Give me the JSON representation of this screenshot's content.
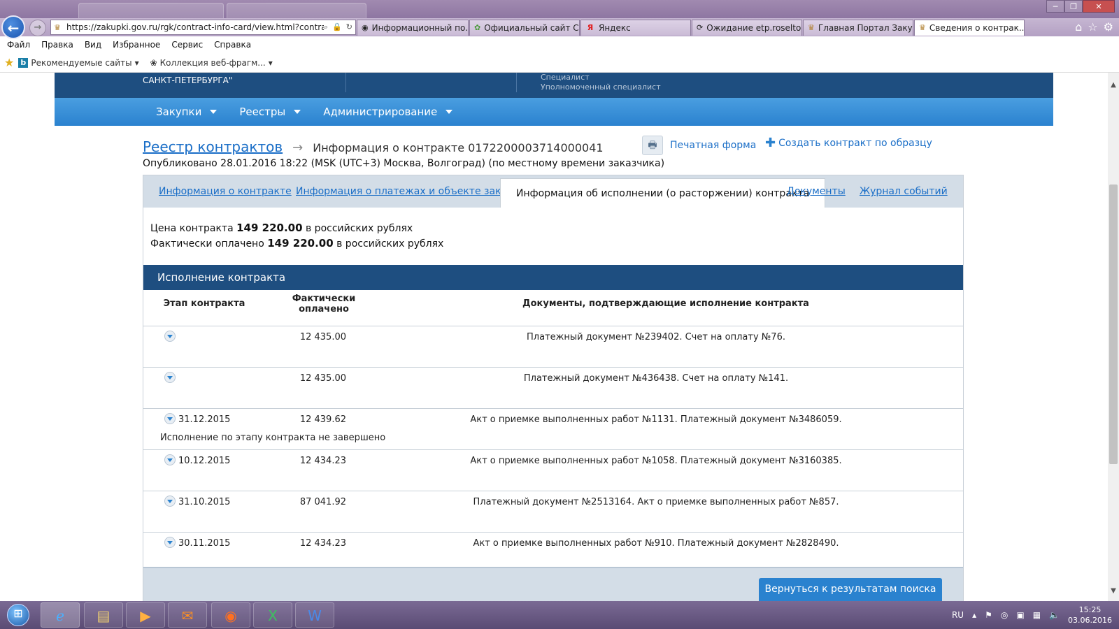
{
  "browser": {
    "url": "https://zakupki.gov.ru/rgk/contract-info-card/view.html?contrac",
    "tabs": [
      {
        "title": "Информационный по...",
        "active": false
      },
      {
        "title": "Официальный сайт Сл...",
        "active": false
      },
      {
        "title": "Яндекс",
        "active": false
      },
      {
        "title": "Ожидание etp.roseltor...",
        "active": false
      },
      {
        "title": "Главная Портал Закуп...",
        "active": false
      },
      {
        "title": "Сведения о контрак...",
        "active": true
      }
    ],
    "menu": [
      "Файл",
      "Правка",
      "Вид",
      "Избранное",
      "Сервис",
      "Справка"
    ],
    "favorites": [
      "Рекомендуемые сайты",
      "Коллекция веб-фрагм..."
    ]
  },
  "site": {
    "org_name": "САНКТ-ПЕТЕРБУРГА\"",
    "role_1": "Специалист",
    "role_2": "Уполномоченный специалист",
    "nav": [
      "Закупки",
      "Реестры",
      "Администрирование"
    ]
  },
  "page": {
    "breadcrumb_link": "Реестр контрактов",
    "breadcrumb_arrow": "→",
    "title": "Информация о контракте 0172200003714000041",
    "published": "Опубликовано 28.01.2016 18:22 (MSK (UTC+3) Москва, Волгоград) (по местному времени заказчика)",
    "print_label": "Печатная форма",
    "create_label": "Создать контракт по образцу",
    "tabs": [
      {
        "label": "Информация о контракте",
        "active": false
      },
      {
        "label": "Информация о платежах и объекте закупки",
        "active": false
      },
      {
        "label": "Информация об исполнении (о расторжении) контракта",
        "active": true
      },
      {
        "label": "Документы",
        "active": false
      },
      {
        "label": "Журнал событий",
        "active": false
      }
    ],
    "price_prefix": "Цена контракта",
    "price_value": "149 220.00",
    "price_suffix": "в российских рублях",
    "paid_prefix": "Фактически оплачено",
    "paid_value": "149 220.00",
    "paid_suffix": "в российских рублях",
    "section_title": "Исполнение контракта",
    "columns": {
      "stage": "Этап контракта",
      "paid_1": "Фактически",
      "paid_2": "оплачено",
      "docs": "Документы, подтверждающие исполнение контракта"
    },
    "rows": [
      {
        "date": "",
        "amount": "12 435.00",
        "docs": "Платежный документ №239402. Счет на оплату №76.",
        "note": ""
      },
      {
        "date": "",
        "amount": "12 435.00",
        "docs": "Платежный документ №436438. Счет на оплату №141.",
        "note": ""
      },
      {
        "date": "31.12.2015",
        "amount": "12 439.62",
        "docs": "Акт о приемке выполненных работ №1131. Платежный документ №3486059.",
        "note": "Исполнение по этапу контракта не завершено"
      },
      {
        "date": "10.12.2015",
        "amount": "12 434.23",
        "docs": "Акт о приемке выполненных работ №1058. Платежный документ №3160385.",
        "note": ""
      },
      {
        "date": "31.10.2015",
        "amount": "87 041.92",
        "docs": "Платежный документ №2513164. Акт о приемке выполненных работ №857.",
        "note": ""
      },
      {
        "date": "30.11.2015",
        "amount": "12 434.23",
        "docs": "Акт о приемке выполненных работ №910. Платежный документ №2828490.",
        "note": ""
      }
    ],
    "return_label": "Вернуться к результатам поиска"
  },
  "taskbar": {
    "lang": "RU",
    "time": "15:25",
    "date": "03.06.2016"
  },
  "colors": {
    "header_dark": "#1e4e80",
    "nav_blue": "#2a82cf",
    "link_blue": "#1a6ec7"
  }
}
